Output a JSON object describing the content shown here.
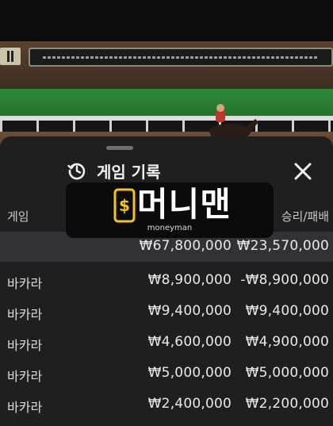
{
  "sheet": {
    "title": "게임 기록",
    "history_icon": "history-icon",
    "close_icon": "close-icon"
  },
  "columns": {
    "game": "게임",
    "result": "승리/패배"
  },
  "totals": {
    "amount": "₩67,800,000",
    "result": "₩23,570,000"
  },
  "rows": [
    {
      "game": "바카라",
      "amount": "₩8,900,000",
      "result": "-₩8,900,000"
    },
    {
      "game": "바카라",
      "amount": "₩9,400,000",
      "result": "₩9,400,000"
    },
    {
      "game": "바카라",
      "amount": "₩4,600,000",
      "result": "₩4,900,000"
    },
    {
      "game": "바카라",
      "amount": "₩5,000,000",
      "result": "₩5,000,000"
    },
    {
      "game": "바카라",
      "amount": "₩2,400,000",
      "result": "₩2,200,000"
    }
  ],
  "watermark": {
    "text": "머니맨",
    "sub": "moneyman",
    "icon": "dollar-phone-icon",
    "accent": "#f5c518"
  }
}
